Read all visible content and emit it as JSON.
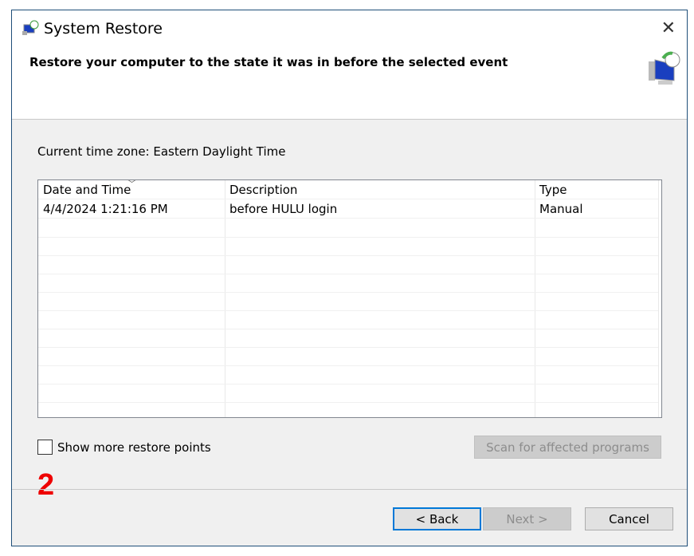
{
  "window": {
    "title": "System Restore",
    "heading": "Restore your computer to the state it was in before the selected event"
  },
  "timezone": "Current time zone: Eastern Daylight Time",
  "table": {
    "columns": [
      "Date and Time",
      "Description",
      "Type"
    ],
    "rows": [
      [
        "4/4/2024 1:21:16 PM",
        "before HULU login",
        "Manual"
      ]
    ]
  },
  "show_more": {
    "label": "Show more restore points",
    "checked": false
  },
  "scan_button": "Scan for affected programs",
  "annotation": "2",
  "buttons": {
    "back": "< Back",
    "next": "Next >",
    "cancel": "Cancel"
  }
}
